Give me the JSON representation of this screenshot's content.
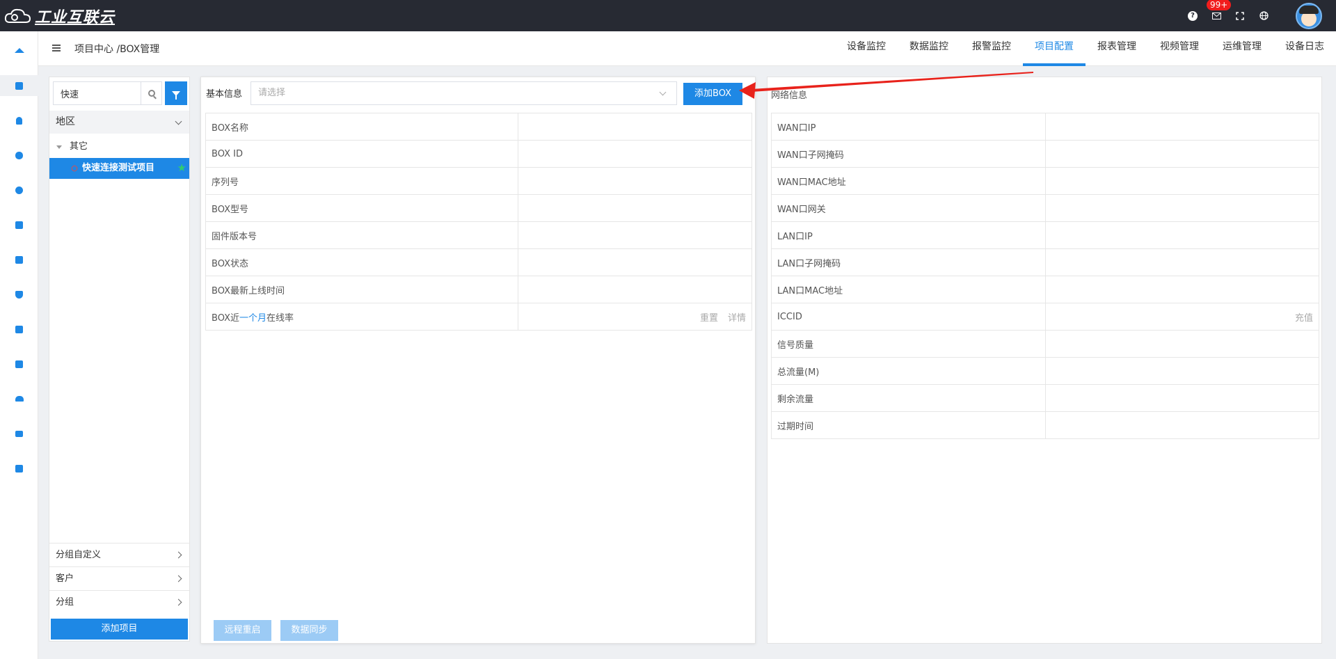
{
  "app": {
    "logo_text": "工业互联云",
    "notification_count": "99+"
  },
  "header": {
    "breadcrumb": "项目中心 /BOX管理",
    "nav": [
      {
        "label": "设备监控"
      },
      {
        "label": "数据监控"
      },
      {
        "label": "报警监控"
      },
      {
        "label": "项目配置"
      },
      {
        "label": "报表管理"
      },
      {
        "label": "视频管理"
      },
      {
        "label": "运维管理"
      },
      {
        "label": "设备日志"
      }
    ],
    "active_nav": "项目配置"
  },
  "project_panel": {
    "search_value": "快速",
    "region_label": "地区",
    "tree_group": "其它",
    "selected_project": "快速连接测试项目",
    "accordions": [
      {
        "label": "分组自定义"
      },
      {
        "label": "客户"
      },
      {
        "label": "分组"
      }
    ],
    "add_project_label": "添加项目"
  },
  "basic_info": {
    "label": "基本信息",
    "select_placeholder": "请选择",
    "add_box_label": "添加BOX",
    "rows": [
      {
        "label": "BOX名称"
      },
      {
        "label": "BOX ID"
      },
      {
        "label": "序列号"
      },
      {
        "label": "BOX型号"
      },
      {
        "label": "固件版本号"
      },
      {
        "label": "BOX状态"
      },
      {
        "label": "BOX最新上线时间"
      }
    ],
    "online_row": {
      "prefix": "BOX近",
      "highlight": "一个月",
      "suffix": "在线率",
      "reset": "重置",
      "detail": "详情"
    },
    "remote_restart_label": "远程重启",
    "data_sync_label": "数据同步"
  },
  "network_info": {
    "title": "网络信息",
    "rows": [
      {
        "label": "WAN口IP"
      },
      {
        "label": "WAN口子网掩码"
      },
      {
        "label": "WAN口MAC地址"
      },
      {
        "label": "WAN口网关"
      },
      {
        "label": "LAN口IP"
      },
      {
        "label": "LAN口子网掩码"
      },
      {
        "label": "LAN口MAC地址"
      },
      {
        "label": "ICCID",
        "action": "充值"
      },
      {
        "label": "信号质量"
      },
      {
        "label": "总流量(M)"
      },
      {
        "label": "剩余流量"
      },
      {
        "label": "过期时间"
      }
    ]
  },
  "colors": {
    "accent": "#1e88e5",
    "topbar": "#272a33",
    "badge": "#f11d1d",
    "annotation": "#e8221b"
  },
  "icons": {
    "rail": [
      "home-icon",
      "layers-icon",
      "bell-icon",
      "database-icon",
      "gear-icon",
      "monitor-icon",
      "building-icon",
      "shield-icon",
      "list-icon",
      "device-settings-icon",
      "users-icon",
      "briefcase-icon",
      "grid-icon"
    ],
    "topbar": [
      "help-icon",
      "mail-icon",
      "fullscreen-icon",
      "globe-icon"
    ]
  }
}
